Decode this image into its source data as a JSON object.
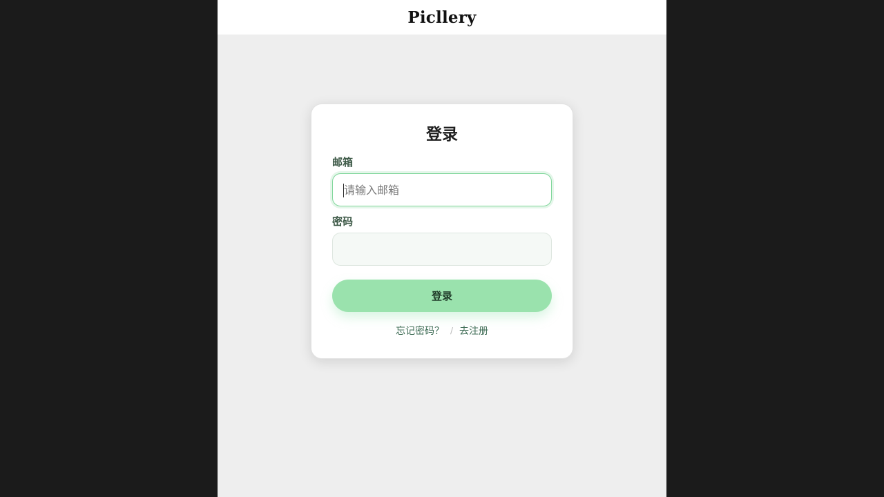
{
  "header": {
    "brand": "Picllery"
  },
  "login": {
    "title": "登录",
    "email_label": "邮箱",
    "email_placeholder": "请输入邮箱",
    "email_value": "",
    "password_label": "密码",
    "password_value": "",
    "submit_label": "登录",
    "forgot_link": "忘记密码？",
    "separator": "/",
    "register_link": "去注册"
  },
  "colors": {
    "accent": "#9ae2ad",
    "focus_border": "#7fd69a",
    "link": "#3d6b54",
    "page_bg": "#eeeeee",
    "outer_bg": "#1b1b1b"
  }
}
